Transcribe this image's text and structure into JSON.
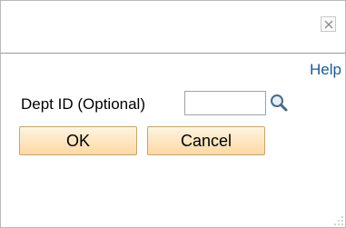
{
  "dialog": {
    "close_glyph": "✕"
  },
  "links": {
    "help": "Help"
  },
  "form": {
    "dept_label": "Dept ID (Optional)",
    "dept_value": "",
    "dept_placeholder": ""
  },
  "buttons": {
    "ok": "OK",
    "cancel": "Cancel"
  },
  "colors": {
    "link": "#1e5a96",
    "button_top": "#fff4e0",
    "button_bottom": "#fcd9a2",
    "button_border": "#c9a46a"
  },
  "icons": {
    "close": "close-icon",
    "lookup": "magnifier-icon",
    "resize": "resize-grip-icon"
  }
}
